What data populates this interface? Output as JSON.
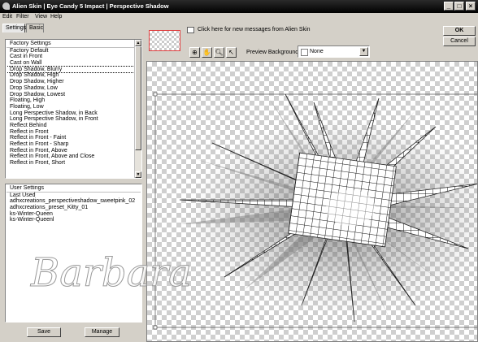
{
  "window": {
    "title": "Alien Skin  |  Eye Candy 5 Impact  |  Perspective Shadow"
  },
  "menu": [
    "Edit",
    "Filter",
    "View",
    "Help"
  ],
  "tabs": [
    {
      "label": "Settings",
      "active": true
    },
    {
      "label": "Basic",
      "active": false
    }
  ],
  "factory_settings": {
    "header": "Factory Settings",
    "items": [
      "Factory Default",
      "Cast in Front",
      "Cast on Wall",
      "Drop Shadow, Blurry",
      "Drop Shadow, High",
      "Drop Shadow, Higher",
      "Drop Shadow, Low",
      "Drop Shadow, Lowest",
      "Floating, High",
      "Floating, Low",
      "Long Perspective Shadow, in Back",
      "Long Perspective Shadow, in Front",
      "Reflect Behind",
      "Reflect in Front",
      "Reflect in Front - Faint",
      "Reflect in Front - Sharp",
      "Reflect in Front, Above",
      "Reflect in Front, Above and Close",
      "Reflect in Front, Short"
    ],
    "selected_index": 3
  },
  "user_settings": {
    "header": "User Settings",
    "items": [
      "Last Used",
      "adhxcreations_perspectiveshadow_sweetpink_02",
      "adhxcreations_preset_Kitty_01",
      "ks-Winter-Queen",
      "ks-Winter-Queenl"
    ]
  },
  "buttons": {
    "save": "Save",
    "manage": "Manage",
    "ok": "OK",
    "cancel": "Cancel"
  },
  "message_link": "Click here for new messages from Alien Skin",
  "preview_background": {
    "label": "Preview Background:",
    "value": "None"
  },
  "watermark": "Barbara",
  "icons": [
    "app-icon",
    "minimize-icon",
    "maximize-icon",
    "close-icon",
    "chat-icon",
    "zoom-fit-icon",
    "hand-icon",
    "zoom-icon",
    "pointer-icon",
    "chevron-down-icon",
    "arrow-up-icon",
    "arrow-down-icon"
  ]
}
